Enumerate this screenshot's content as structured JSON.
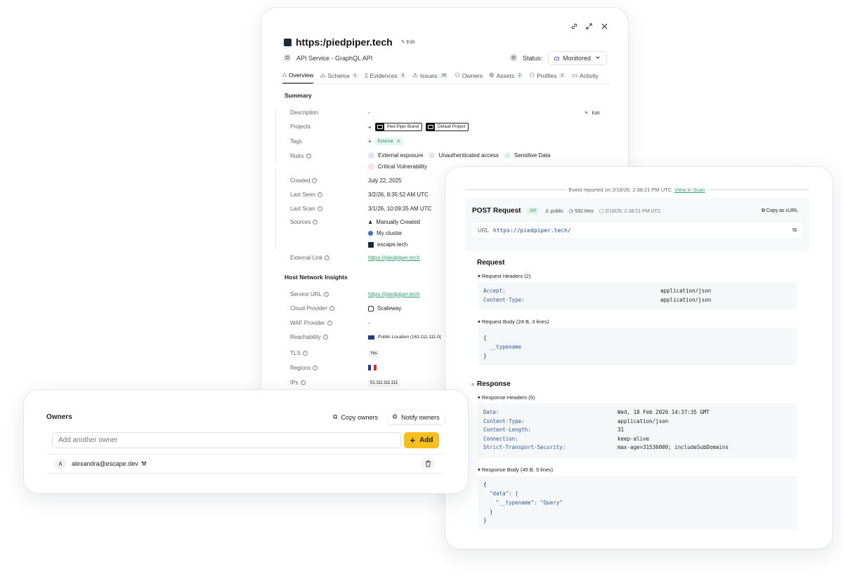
{
  "asset": {
    "url_title": "https:/piedpiper.tech",
    "edit": "Edit",
    "api_service": "API Service - GraphQL API",
    "status_label": "Status:",
    "status_value": "Monitored",
    "tabs": [
      {
        "label": "Overview",
        "count": ""
      },
      {
        "label": "Schema",
        "count": "1"
      },
      {
        "label": "Evidences",
        "count": "3"
      },
      {
        "label": "Issues",
        "count": "26"
      },
      {
        "label": "Owners",
        "count": ""
      },
      {
        "label": "Assets",
        "count": "2"
      },
      {
        "label": "Profiles",
        "count": "2"
      },
      {
        "label": "Activity",
        "count": ""
      }
    ],
    "summary_heading": "Summary",
    "description_label": "Description",
    "description_value": "-",
    "desc_edit": "Edit",
    "projects_label": "Projects",
    "projects": [
      "Pied Piper Brand",
      "Default Project"
    ],
    "tags_label": "Tags",
    "tag": "External",
    "risks_label": "Risks",
    "risks": [
      "External exposure",
      "Unauthenticated access",
      "Sensitive Data",
      "Critical Vulnerability"
    ],
    "created_label": "Created",
    "created_value": "July 22, 2025",
    "last_seen_label": "Last Seen",
    "last_seen_value": "3/2/26, 8:35:52 AM UTC",
    "last_scan_label": "Last Scan",
    "last_scan_value": "3/1/26, 10:09:35 AM UTC",
    "sources_label": "Sources",
    "sources": [
      "Manually Created",
      "My cluster",
      "escape.tech"
    ],
    "external_link_label": "External Link",
    "external_link_value": "https://piedpiper.tech",
    "host_heading": "Host Network Insights",
    "service_url_label": "Service URL",
    "service_url_value": "https://piedpiper.tech",
    "cloud_label": "Cloud Provider",
    "cloud_value": "Scaleway",
    "waf_label": "WAF Provider",
    "waf_value": "-",
    "reach_label": "Reachability",
    "reach_value": "Public Location (163.111.111.0(",
    "tls_label": "TLS",
    "tls_value": "Yes",
    "regions_label": "Regions",
    "ips_label": "IPs",
    "ips_value": "51.111.111.111"
  },
  "owners": {
    "title": "Owners",
    "copy_btn": "Copy owners",
    "notify_btn": "Notify owners",
    "input_placeholder": "Add another owner",
    "add_btn": "Add",
    "owner_initial": "A",
    "owner_email": "alexandra@escape.dev"
  },
  "event": {
    "reported": "Event reported on 2/18/26, 2:38:21 PM UTC",
    "view_in_scan": "View in Scan",
    "method": "POST Request",
    "status_code": "200",
    "visibility": "public",
    "duration": "532.0ms",
    "timestamp": "2/18/26, 2:38:21 PM UTC",
    "copy_curl": "Copy as cURL",
    "url_label": "URL",
    "url_value": "https://piedpiper.tech/",
    "request_heading": "Request",
    "request_headers_label": "▾ Request Headers (2)",
    "request_headers": [
      {
        "k": "Accept:",
        "v": "application/json"
      },
      {
        "k": "Content-Type:",
        "v": "application/json"
      }
    ],
    "request_body_label": "▾ Request Body (24 B, 3 lines)",
    "request_body": [
      "{",
      "  __typename",
      "}"
    ],
    "response_heading": "Response",
    "response_headers_label": "▾ Response Headers (5)",
    "response_headers": [
      {
        "k": "Date:",
        "v": "Wed, 18 Feb 2026 14:37:35 GMT"
      },
      {
        "k": "Content-Type:",
        "v": "application/json"
      },
      {
        "k": "Content-Length:",
        "v": "31"
      },
      {
        "k": "Connection:",
        "v": "keep-alive"
      },
      {
        "k": "Strict-Transport-Security:",
        "v": "max-age=31536000; includeSubDomains"
      }
    ],
    "response_body_label": "▾ Response Body (45 B, 5 lines)",
    "response_body": [
      "{",
      "  \"data\": {",
      "    \"__typename\": \"Query\"",
      "  }",
      "}"
    ]
  },
  "colors": {
    "accent_yellow": "#f7be1e",
    "link_green": "#2fa36f",
    "code_blue": "#2c5a9c"
  }
}
